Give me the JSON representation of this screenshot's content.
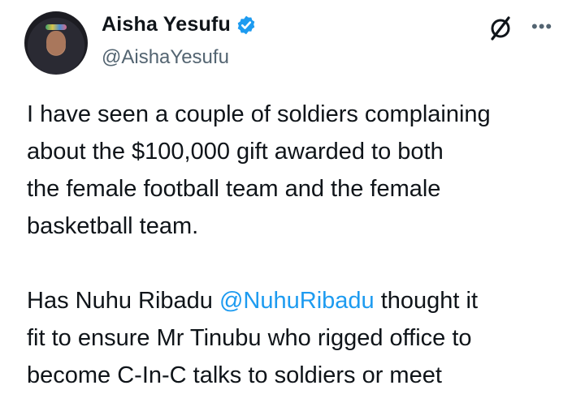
{
  "author": {
    "name": "Aisha Yesufu",
    "handle": "@AishaYesufu",
    "verified": true
  },
  "icons": {
    "grok": "grok-icon",
    "more": "more-icon",
    "verified": "verified-badge-icon"
  },
  "tweet": {
    "p1_lines": [
      "I have seen a couple of soldiers complaining",
      "about the $100,000 gift awarded to both",
      "the female football team and the female",
      "basketball team."
    ],
    "p2_line1_pre": "Has Nuhu Ribadu ",
    "p2_mention": "@NuhuRibadu",
    "p2_line1_post": " thought it",
    "p2_lines": [
      "fit to ensure Mr Tinubu who rigged office to",
      "become C-In-C talks to soldiers or meet"
    ]
  },
  "colors": {
    "text": "#0f1419",
    "muted": "#536471",
    "link": "#1d9bf0",
    "badge": "#1d9bf0"
  }
}
